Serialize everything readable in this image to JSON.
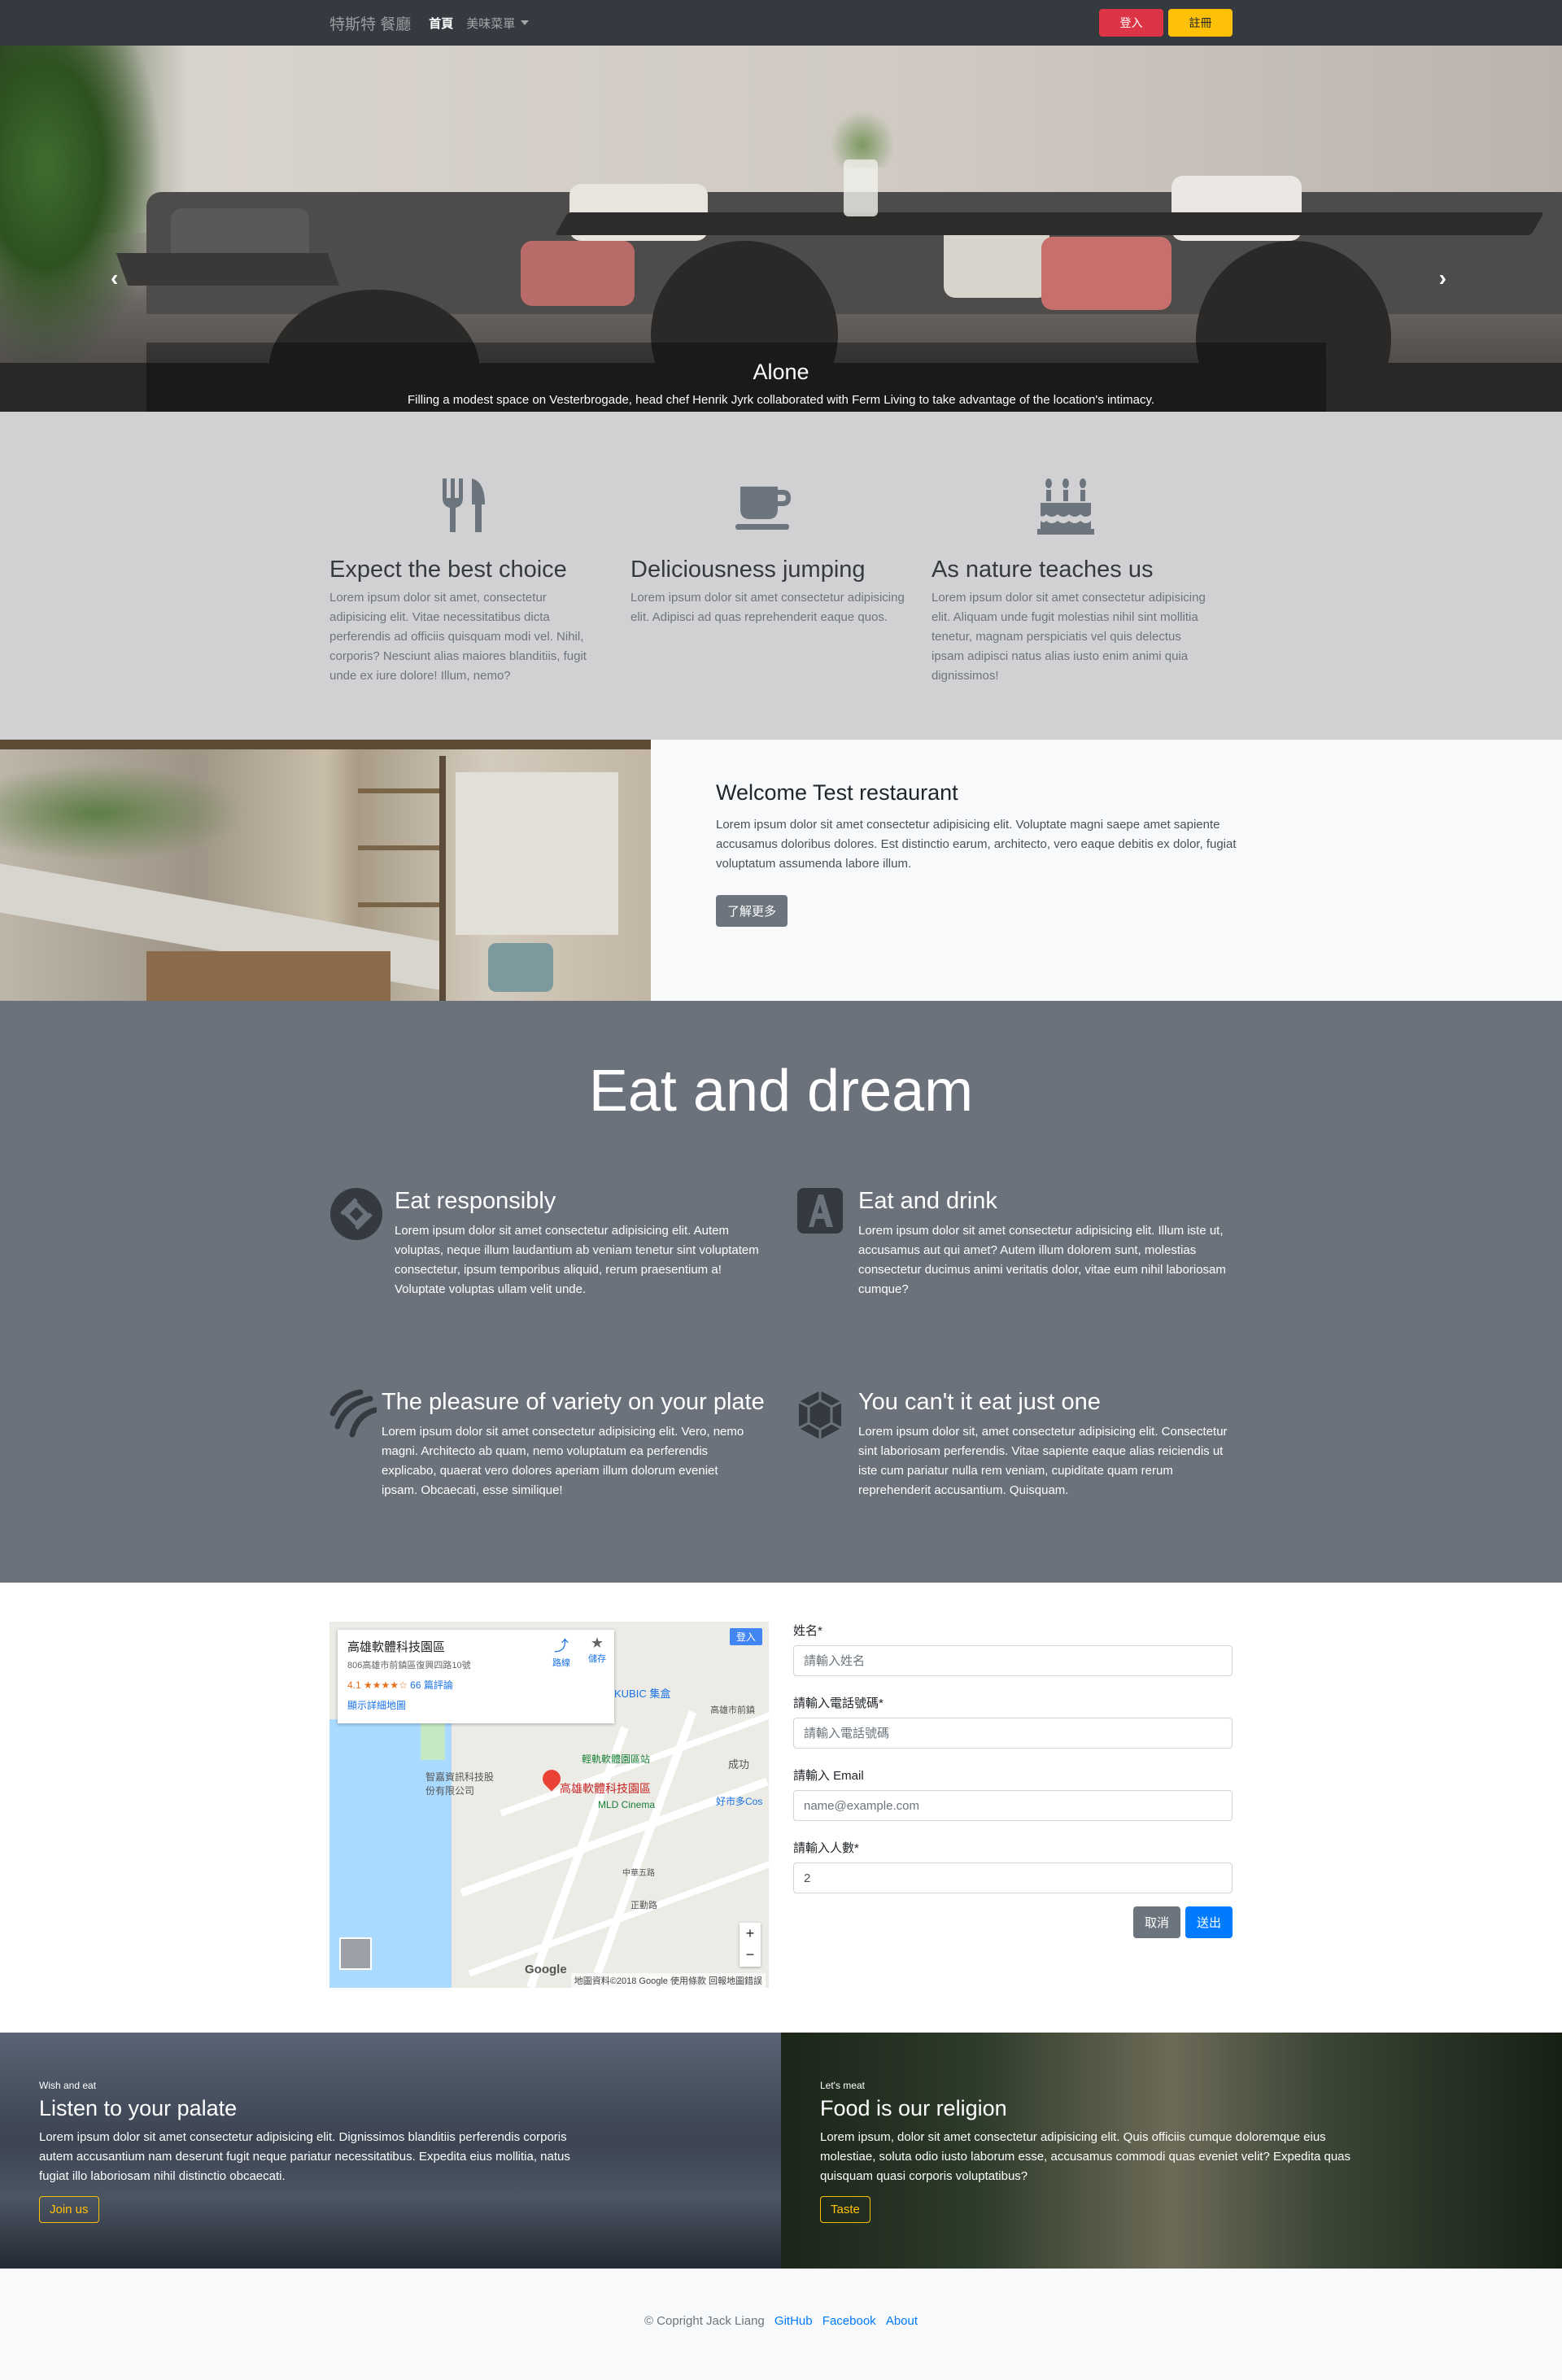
{
  "navbar": {
    "brand": "特斯特 餐廳",
    "links": {
      "home": "首頁",
      "menu": "美味菜單"
    },
    "login": "登入",
    "register": "註冊"
  },
  "hero": {
    "title": "Alone",
    "text": "Filling a modest space on Vesterbrogade, head chef Henrik Jyrk collaborated with Ferm Living to take advantage of the location's intimacy.",
    "prev": "‹",
    "next": "›"
  },
  "features": [
    {
      "icon": "utensils-icon",
      "title": "Expect the best choice",
      "text": "Lorem ipsum dolor sit amet, consectetur adipisicing elit. Vitae necessitatibus dicta perferendis ad officiis quisquam modi vel. Nihil, corporis? Nesciunt alias maiores blanditiis, fugit unde ex iure dolore! Illum, nemo?"
    },
    {
      "icon": "coffee-icon",
      "title": "Deliciousness jumping",
      "text": "Lorem ipsum dolor sit amet consectetur adipisicing elit. Adipisci ad quas reprehenderit eaque quos."
    },
    {
      "icon": "birthday-cake-icon",
      "title": "As nature teaches us",
      "text": "Lorem ipsum dolor sit amet consectetur adipisicing elit. Aliquam unde fugit molestias nihil sint mollitia tenetur, magnam perspiciatis vel quis delectus ipsam adipisci natus alias iusto enim animi quia dignissimos!"
    }
  ],
  "welcome": {
    "title": "Welcome Test restaurant",
    "text": "Lorem ipsum dolor sit amet consectetur adipisicing elit. Voluptate magni saepe amet sapiente accusamus doloribus dolores. Est distinctio earum, architecto, vero eaque debitis ex dolor, fugiat voluptatum assumenda labore illum.",
    "button": "了解更多"
  },
  "dream": {
    "title": "Eat and dream",
    "items": [
      {
        "icon": "diamond-icon",
        "title": "Eat responsibly",
        "text": "Lorem ipsum dolor sit amet consectetur adipisicing elit. Autem voluptas, neque illum laudantium ab veniam tenetur sint voluptatem consectetur, ipsum temporibus aliquid, rerum praesentium a! Voluptate voluptas ullam velit unde."
      },
      {
        "icon": "letter-a-icon",
        "title": "Eat and drink",
        "text": "Lorem ipsum dolor sit amet consectetur adipisicing elit. Illum iste ut, accusamus aut qui amet? Autem illum dolorem sunt, molestias consectetur ducimus animi veritatis dolor, vitae eum nihil laboriosam cumque?"
      },
      {
        "icon": "stripes-icon",
        "title": "The pleasure of variety on your plate",
        "text": "Lorem ipsum dolor sit amet consectetur adipisicing elit. Vero, nemo magni. Architecto ab quam, nemo voluptatum ea perferendis explicabo, quaerat vero dolores aperiam illum dolorum eveniet ipsam. Obcaecati, esse similique!"
      },
      {
        "icon": "emblem-icon",
        "title": "You can't it eat just one",
        "text": "Lorem ipsum dolor sit, amet consectetur adipisicing elit. Consectetur sint laboriosam perferendis. Vitae sapiente eaque alias reiciendis ut iste cum pariatur nulla rem veniam, cupiditate quam rerum reprehenderit accusantium. Quisquam."
      }
    ]
  },
  "map": {
    "place": "高雄軟體科技園區",
    "address": "806高雄市前鎮區復興四路10號",
    "rating": "4.1 ★★★★☆",
    "reviews": "66 篇評論",
    "larger": "顯示詳細地圖",
    "directions": "路線",
    "save": "儲存",
    "login": "登入",
    "pin_label": "高雄軟體科技園區",
    "labels": [
      "KUBIC 集盒",
      "高雄市前鎮",
      "輕軌軟體園區站",
      "智嘉資訊科技股份有限公司",
      "MLD Cinema",
      "成功",
      "好市多Cos",
      "中華五路",
      "正勤路"
    ],
    "google": "Google",
    "footer": "地圖資料©2018 Google   使用條款   回報地圖錯誤",
    "zoom_in": "+",
    "zoom_out": "−"
  },
  "form": {
    "name_label": "姓名*",
    "name_placeholder": "請輸入姓名",
    "phone_label": "請輸入電話號碼*",
    "phone_placeholder": "請輸入電話號碼",
    "email_label": "請輸入 Email",
    "email_placeholder": "name@example.com",
    "people_label": "請輸入人數*",
    "people_value": "2",
    "cancel": "取消",
    "submit": "送出"
  },
  "promo": [
    {
      "eyebrow": "Wish and eat",
      "title": "Listen to your palate",
      "text": "Lorem ipsum dolor sit amet consectetur adipisicing elit. Dignissimos blanditiis perferendis corporis autem accusantium nam deserunt fugit neque pariatur necessitatibus. Expedita eius mollitia, natus fugiat illo laboriosam nihil distinctio obcaecati.",
      "button": "Join us"
    },
    {
      "eyebrow": "Let's meat",
      "title": "Food is our religion",
      "text": "Lorem ipsum, dolor sit amet consectetur adipisicing elit. Quis officiis cumque doloremque eius molestiae, soluta odio iusto laborum esse, accusamus commodi quas eveniet velit? Expedita quas quisquam quasi corporis voluptatibus?",
      "button": "Taste"
    }
  ],
  "footer": {
    "copyright": "© Copright Jack Liang",
    "github": "GitHub",
    "facebook": "Facebook",
    "about": "About"
  }
}
